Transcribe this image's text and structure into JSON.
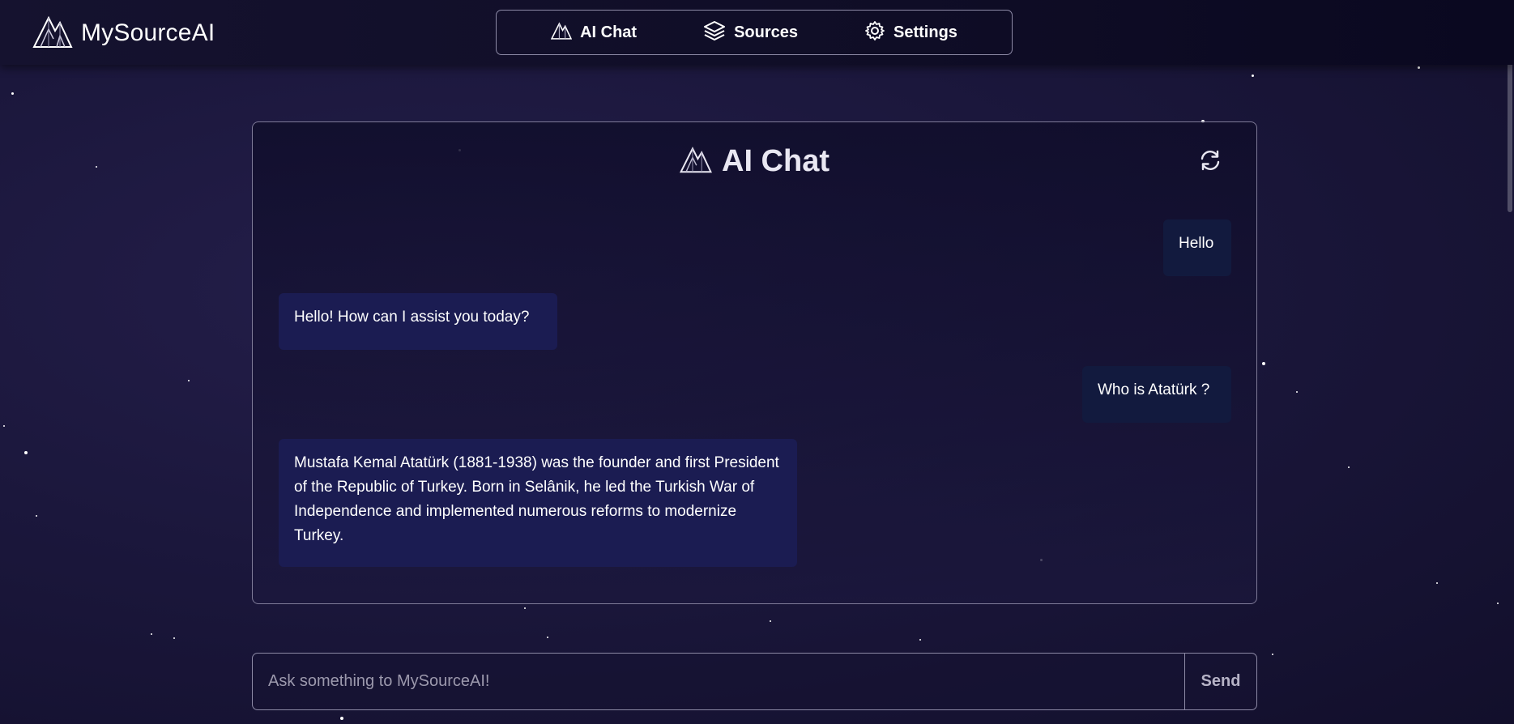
{
  "brand": {
    "name": "MySourceAI",
    "logo_icon": "mountain-logo-icon"
  },
  "nav": {
    "items": [
      {
        "label": "AI Chat",
        "icon": "mountain-logo-icon"
      },
      {
        "label": "Sources",
        "icon": "layers-icon"
      },
      {
        "label": "Settings",
        "icon": "gear-icon"
      }
    ]
  },
  "chat": {
    "title": "AI Chat",
    "refresh_icon": "refresh-icon",
    "messages": [
      {
        "role": "user",
        "text": "Hello"
      },
      {
        "role": "assistant",
        "text": "Hello! How can I assist you today?"
      },
      {
        "role": "user",
        "text": "Who is Atatürk ?"
      },
      {
        "role": "assistant",
        "text": "Mustafa Kemal Atatürk (1881-1938) was the founder and first President of the Republic of Turkey. Born in Selânik, he led the Turkish War of Independence and implemented numerous reforms to modernize Turkey."
      }
    ]
  },
  "composer": {
    "placeholder": "Ask something to MySourceAI!",
    "value": "",
    "send_label": "Send"
  },
  "colors": {
    "background": "#1b173c",
    "user_bubble": "#121a3e",
    "assistant_bubble": "#1b1c52",
    "border": "#8d8aa6"
  }
}
